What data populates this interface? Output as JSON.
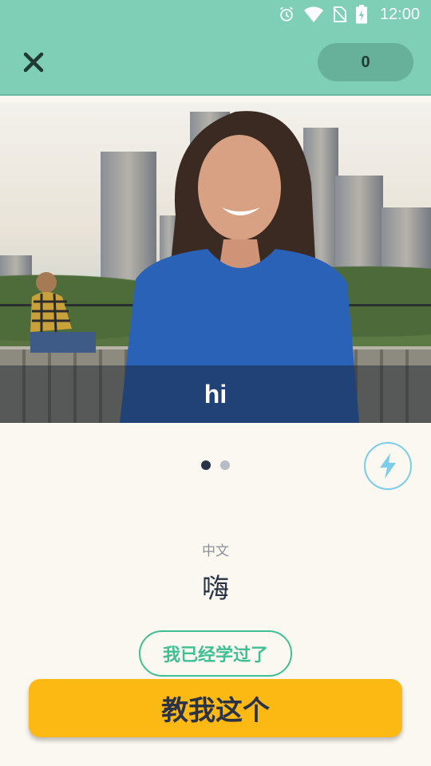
{
  "status_bar": {
    "time": "12:00",
    "icons": [
      "alarm-icon",
      "wifi-icon",
      "no-sim-icon",
      "battery-charging-icon"
    ]
  },
  "app_bar": {
    "close_icon": "close-icon",
    "score": "0"
  },
  "video": {
    "caption": "hi"
  },
  "pager": {
    "total": 2,
    "active_index": 0
  },
  "boost_icon": "lightning-bolt-icon",
  "translation": {
    "language_label": "中文",
    "word": "嗨"
  },
  "buttons": {
    "already_learned": "我已经学过了",
    "teach_me": "教我这个"
  },
  "colors": {
    "header": "#7fceb6",
    "score_pill": "#67b09a",
    "background": "#fbf8f1",
    "accent_green": "#3fbf94",
    "primary_button": "#fdb913",
    "bolt": "#7ccde9",
    "text_dark": "#2a3245"
  }
}
